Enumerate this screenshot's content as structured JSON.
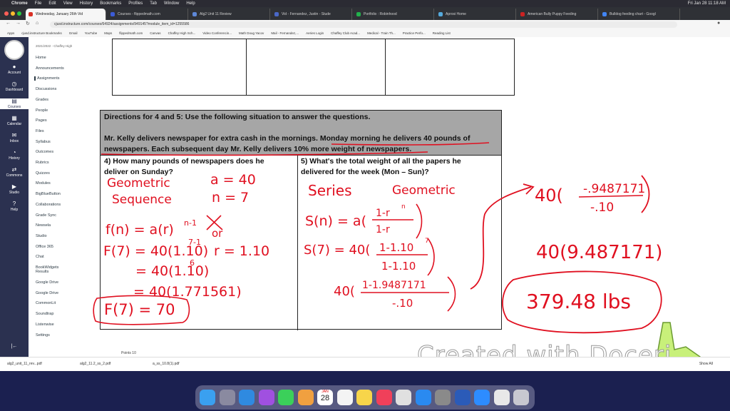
{
  "menubar": {
    "apple": "",
    "items": [
      "Chrome",
      "File",
      "Edit",
      "View",
      "History",
      "Bookmarks",
      "Profiles",
      "Tab",
      "Window",
      "Help"
    ],
    "clock": "Fri Jan 28  11:18 AM"
  },
  "tabs": [
    {
      "label": "Wednesday, January 26th Vid",
      "color": "#d93025"
    },
    {
      "label": "Courses - flippedmath.com",
      "color": "#3b5bd6"
    },
    {
      "label": "Alg2 Unit 11 Review",
      "color": "#5e88d8"
    },
    {
      "label": "Vid - Fernandez, Justin - Stude",
      "color": "#4a68c8"
    },
    {
      "label": "Portfolio : Robinhood",
      "color": "#22b14c"
    },
    {
      "label": "Aprosi Home",
      "color": "#55aadd"
    },
    {
      "label": "American Bully Puppy Feeding",
      "color": "#cc2222"
    },
    {
      "label": "Bulldog feeding chart - Googl",
      "color": "#4285f4"
    }
  ],
  "url": "cjusd.instructure.com/courses/64924/assignments/949145?module_item_id=1255586",
  "bookmarks": [
    "Apps",
    "cjusd.instructure Bookmarks",
    "Gmail",
    "YouTube",
    "Maps",
    "flippedmath.com",
    "Canvas",
    "Chaffey High Sch...",
    "Video Conferencin...",
    "Math Doug Yacov",
    "Mail - Fernandez,...",
    "Aeries Login",
    "Chaffey Club Acad...",
    "Medical - Train Th...",
    "Practice Perfo...",
    "Reading List"
  ],
  "sidebar": {
    "items": [
      {
        "label": "Account",
        "icon": "account-icon",
        "glyph": "●"
      },
      {
        "label": "Dashboard",
        "icon": "dashboard-icon",
        "glyph": "◷"
      },
      {
        "label": "Courses",
        "icon": "courses-icon",
        "glyph": "▤"
      },
      {
        "label": "Calendar",
        "icon": "calendar-icon",
        "glyph": "▦"
      },
      {
        "label": "Inbox",
        "icon": "inbox-icon",
        "glyph": "✉"
      },
      {
        "label": "History",
        "icon": "history-icon",
        "glyph": "◔"
      },
      {
        "label": "Commons",
        "icon": "commons-icon",
        "glyph": "⇄"
      },
      {
        "label": "Studio",
        "icon": "studio-icon",
        "glyph": "▶"
      },
      {
        "label": "Help",
        "icon": "help-icon",
        "glyph": "?"
      }
    ],
    "collapse": "|←"
  },
  "coursenav": {
    "crumb": "2021/2022 - Chaffey High",
    "items": [
      "Home",
      "Announcements",
      "Assignments",
      "Discussions",
      "Grades",
      "People",
      "Pages",
      "Files",
      "Syllabus",
      "Outcomes",
      "Rubrics",
      "Quizzes",
      "Modules",
      "BigBlueButton",
      "Collaborations",
      "Grade Sync",
      "Newsela",
      "Studio",
      "Office 365",
      "Chat",
      "BookWidgets Results",
      "Google Drive",
      "Google Drive",
      "CommonLit",
      "Soundtrap",
      "Listenwise",
      "Settings"
    ],
    "selected": "Assignments"
  },
  "worksheet": {
    "directions": "Directions for 4 and 5: Use the following situation to answer the questions.",
    "scenario_a": "Mr. Kelly delivers newspaper for extra cash in the mornings.  Monday morning he delivers 40 pounds of",
    "scenario_b": "newspapers.  Each subsequent day Mr. Kelly delivers 10% more weight of newspapers.",
    "q4_line1": "4) How many pounds of newspapers does he",
    "q4_line2": "deliver on Sunday?",
    "q5_line1": "5)  What's the total weight of all the papers he",
    "q5_line2": "delivered for the week (Mon – Sun)?"
  },
  "handwriting": {
    "q4": {
      "geometric": "Geometric",
      "sequence": "Sequence",
      "a": "a = 40",
      "n": "n = 7",
      "formula": "f(n) = a(r)",
      "formula_exp": "n-1",
      "or": "or",
      "r": "r = 1.10",
      "step1": "F(7) = 40(1.10)",
      "step1_exp": "7-1",
      "step2": "= 40(1.10)",
      "step2_exp": "6",
      "step3": "= 40(1.771561)",
      "answer": "F(7) = 70"
    },
    "q5": {
      "series": "Series",
      "geometric": "Geometric",
      "sn": "S(n) = a(",
      "frac_num": "1-r",
      "frac_num_exp": "n",
      "frac_den": "1-r",
      "s7": "S(7) = 40(",
      "s7_num": "1-1.10",
      "s7_num_exp": "7",
      "s7_den": "1-1.10",
      "step2": "40(",
      "step2_num": "1-1.9487171",
      "step2_den": "-.10"
    },
    "side": {
      "step3": "40(",
      "step3_num": "-.9487171",
      "step3_den": "-.10",
      "step4": "40(9.487171)",
      "answer": "379.48 lbs"
    }
  },
  "points_label": "Points  10",
  "watermark": "Created with Doceri",
  "downloads": [
    "alg2_unit_11_rev...pdf",
    "alg2_11.2_ss_2.pdf",
    "a_ss_10.8(1).pdf"
  ],
  "downloads_show_all": "Show All",
  "dock": {
    "icons": [
      {
        "name": "finder-icon",
        "color": "#3aa0f0"
      },
      {
        "name": "launchpad-icon",
        "color": "#8a8aa0"
      },
      {
        "name": "safari-icon",
        "color": "#2f8ae0"
      },
      {
        "name": "podcasts-icon",
        "color": "#a050e0"
      },
      {
        "name": "messages-icon",
        "color": "#3bd05a"
      },
      {
        "name": "photos-icon",
        "color": "#f0a040"
      },
      {
        "name": "calendar-icon",
        "color": "#ffffff"
      },
      {
        "name": "reminders-icon",
        "color": "#f4f4f4"
      },
      {
        "name": "notes-icon",
        "color": "#f7d54a"
      },
      {
        "name": "music-icon",
        "color": "#f0405a"
      },
      {
        "name": "chrome-icon",
        "color": "#e0e0e0"
      },
      {
        "name": "appstore-icon",
        "color": "#2a8af0"
      },
      {
        "name": "settings-icon",
        "color": "#8a8a8a"
      },
      {
        "name": "word-icon",
        "color": "#2b5bb8"
      },
      {
        "name": "zoom-icon",
        "color": "#2d8cff"
      },
      {
        "name": "file-icon",
        "color": "#e8e8e8"
      },
      {
        "name": "trash-icon",
        "color": "#c8c8d0"
      }
    ],
    "calendar_month": "JAN",
    "calendar_day": "28"
  }
}
